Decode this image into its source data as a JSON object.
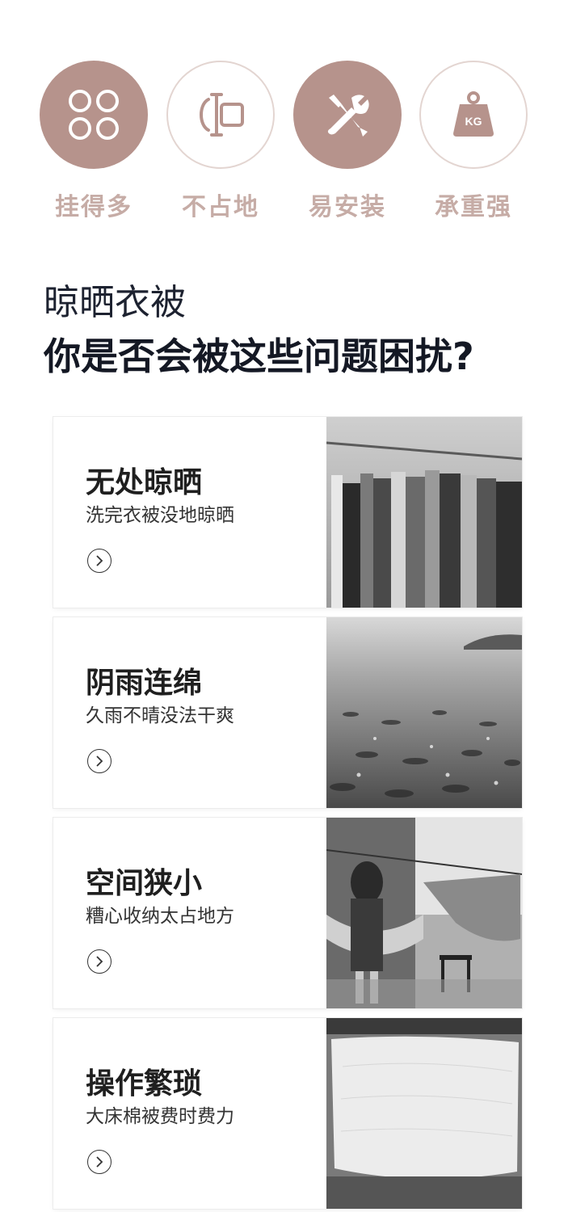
{
  "features": [
    {
      "label": "挂得多",
      "icon": "four-leaf-icon",
      "style": "filled"
    },
    {
      "label": "不占地",
      "icon": "compact-bracket-icon",
      "style": "outlined"
    },
    {
      "label": "易安装",
      "icon": "tools-icon",
      "style": "filled"
    },
    {
      "label": "承重强",
      "icon": "weight-kg-icon",
      "style": "outlined",
      "icon_text": "KG"
    }
  ],
  "heading": {
    "line1": "晾晒衣被",
    "line2": "你是否会被这些问题困扰?"
  },
  "cards": [
    {
      "title": "无处晾晒",
      "desc": "洗完衣被没地晾晒",
      "photo": "clothes-rack-photo"
    },
    {
      "title": "阴雨连绵",
      "desc": "久雨不晴没法干爽",
      "photo": "rain-photo"
    },
    {
      "title": "空间狭小",
      "desc": "糟心收纳太占地方",
      "photo": "cramped-balcony-photo"
    },
    {
      "title": "操作繁琐",
      "desc": "大床棉被费时费力",
      "photo": "quilt-photo"
    }
  ],
  "colors": {
    "accent": "#b6938c",
    "accent_light": "#c6aca6",
    "heading": "#141824"
  }
}
